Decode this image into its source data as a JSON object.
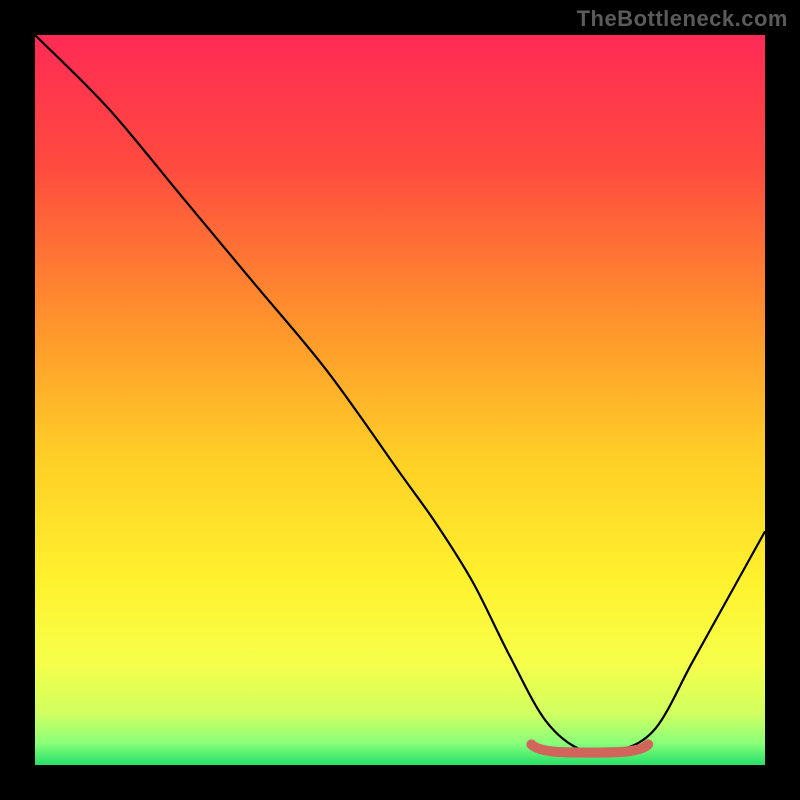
{
  "watermark": "TheBottleneck.com",
  "chart_data": {
    "type": "line",
    "title": "",
    "xlabel": "",
    "ylabel": "",
    "xlim": [
      0,
      100
    ],
    "ylim": [
      0,
      100
    ],
    "x": [
      0,
      10,
      20,
      30,
      40,
      50,
      55,
      60,
      65,
      70,
      75,
      80,
      85,
      90,
      95,
      100
    ],
    "values": [
      100,
      90,
      78,
      66,
      54,
      40,
      33,
      25,
      15,
      6,
      2,
      2,
      5,
      14,
      23,
      32
    ],
    "highlight_range_x": [
      68,
      84
    ],
    "highlight_y": 2,
    "background_gradient_stops": [
      {
        "pos": 0.0,
        "color": "#ff2a55"
      },
      {
        "pos": 0.18,
        "color": "#ff4b3f"
      },
      {
        "pos": 0.38,
        "color": "#ff8f2d"
      },
      {
        "pos": 0.58,
        "color": "#ffcf26"
      },
      {
        "pos": 0.75,
        "color": "#fff22e"
      },
      {
        "pos": 0.86,
        "color": "#f6ff4a"
      },
      {
        "pos": 0.93,
        "color": "#d0ff60"
      },
      {
        "pos": 0.97,
        "color": "#8aff7a"
      },
      {
        "pos": 1.0,
        "color": "#25e06a"
      }
    ],
    "curve_color": "#000000",
    "highlight_color": "#d1655c"
  }
}
